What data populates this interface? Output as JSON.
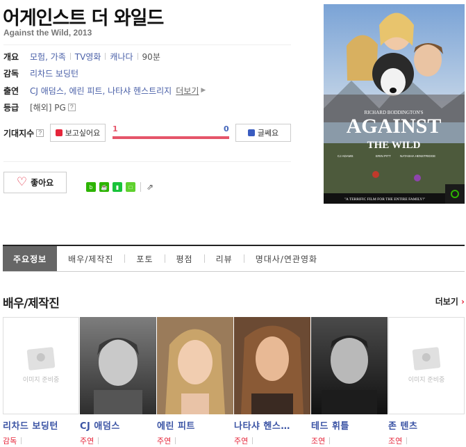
{
  "movie": {
    "title": "어게인스트 더 와일드",
    "subtitle": "Against the Wild, 2013"
  },
  "overview": {
    "label": "개요",
    "genre": "모험, 가족",
    "type": "TV영화",
    "country": "캐나다",
    "runtime": "90분"
  },
  "director": {
    "label": "감독",
    "name": "리차드 보딩턴"
  },
  "cast_line": {
    "label": "출연",
    "names": "CJ 애덤스, 에린 피트, 나타샤 헨스트리지",
    "more": "더보기"
  },
  "rating": {
    "label": "등급",
    "value": "[해외] PG",
    "help_icon": "?"
  },
  "expectation": {
    "label": "기대지수",
    "want_label": "보고싶어요",
    "nah_label": "글쎄요",
    "want_count": "1",
    "nah_count": "0"
  },
  "like_button": {
    "label": "좋아요"
  },
  "poster": {
    "top_credit": "RICHARD BODDINGTON'S",
    "title_line1": "AGAINST",
    "title_line2": "THE WILD",
    "cast1": "CJ ADAMS",
    "cast2": "ERIN PITT",
    "cast3": "NATASHA HENSTRIDGE",
    "tagline": "\"A TERRIFIC FILM FOR THE ENTIRE FAMILY!\""
  },
  "tabs": [
    "주요정보",
    "배우/제작진",
    "포토",
    "평점",
    "리뷰",
    "명대사/연관영화"
  ],
  "cast_section": {
    "title": "배우/제작진",
    "more": "더보기",
    "no_image": "이미지 준비중",
    "members": [
      {
        "name": "리차드 보딩턴",
        "role": "감독"
      },
      {
        "name": "CJ 애덤스",
        "role": "주연"
      },
      {
        "name": "에린 피트",
        "role": "주연"
      },
      {
        "name": "나타샤 헨스…",
        "role": "주연"
      },
      {
        "name": "테드 휘틀",
        "role": "조연"
      },
      {
        "name": "존 텐츠",
        "role": "조연"
      }
    ]
  },
  "colors": {
    "accent_red": "#e5253a",
    "link_blue": "#4a60a8",
    "tab_active": "#666666"
  }
}
